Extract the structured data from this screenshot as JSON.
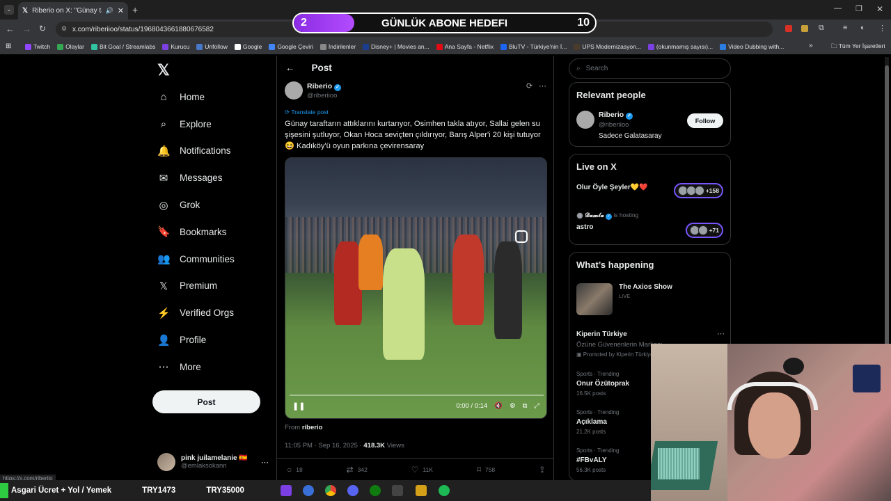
{
  "browser": {
    "tab_title": "Riberio on X: \"Günay taraftı",
    "url": "x.com/riberiioo/status/1968043661880676582",
    "status_url": "https://x.com/riberiio"
  },
  "bookmarks": [
    {
      "label": "Twitch",
      "color": "#9146ff"
    },
    {
      "label": "Olaylar",
      "color": "#34a853"
    },
    {
      "label": "Bit Goal / Streamlabs",
      "color": "#31c3a2"
    },
    {
      "label": "Kurucu",
      "color": "#7b3fe4"
    },
    {
      "label": "Unfollow",
      "color": "#4a78c9"
    },
    {
      "label": "Google",
      "color": "#ffffff"
    },
    {
      "label": "Google Çeviri",
      "color": "#4285f4"
    },
    {
      "label": "İndirilenler",
      "color": "#888888"
    },
    {
      "label": "Disney+ | Movies an...",
      "color": "#1a3d8f"
    },
    {
      "label": "Ana Sayfa - Netflix",
      "color": "#e50914"
    },
    {
      "label": "BluTV - Türkiye'nin İ...",
      "color": "#1c64f2"
    },
    {
      "label": "UPS Modernizasyon...",
      "color": "#4a3b2a"
    },
    {
      "label": "(okunmamış sayısı)...",
      "color": "#7b3fe4"
    },
    {
      "label": "Video Dubbing with...",
      "color": "#2a7de1"
    }
  ],
  "bookmarks_more": "»",
  "bookmarks_all": "Tüm Yer İşaretleri",
  "goal": {
    "current": "2",
    "label": "GÜNLÜK ABONE HEDEFI",
    "target": "10",
    "progress": 0.2
  },
  "nav": {
    "items": [
      "Home",
      "Explore",
      "Notifications",
      "Messages",
      "Grok",
      "Bookmarks",
      "Communities",
      "Premium",
      "Verified Orgs",
      "Profile",
      "More"
    ],
    "post_label": "Post",
    "account_name": "pink juilamelanie 🇪🇸",
    "account_handle": "@emlaksokann"
  },
  "post": {
    "header": "Post",
    "author_name": "Riberio",
    "author_handle": "@riberiioo",
    "translate": "Translate post",
    "text_line1": "Günay taraftarın attıklarını kurtarıyor, Osimhen takla atıyor, Sallai gelen su",
    "text_line2": "şişesini şutluyor, Okan Hoca seviçten çıldırıyor, Barış Alper'i 20 kişi tutuyor",
    "text_line3": "😆 Kadıköy'ü oyun parkına çevirensaray",
    "video_time": "0:00 / 0:14",
    "from_label": "From",
    "from_user": "riberio",
    "timestamp": "11:05 PM · Sep 16, 2025 · ",
    "views_count": "418.3K",
    "views_label": "Views",
    "replies": "18",
    "reposts": "342",
    "likes": "11K",
    "bookmarks": "758"
  },
  "search": {
    "placeholder": "Search"
  },
  "relevant": {
    "title": "Relevant people",
    "name": "Riberio",
    "handle": "@riberiioo",
    "bio": "Sadece Galatasaray",
    "follow": "Follow"
  },
  "live": {
    "title": "Live on X",
    "space1": "Olur Öyle Şeyler💛❤️",
    "space1_count": "+158",
    "host_name": "𝓓𝓪𝓶𝓵𝓪",
    "host_label": "is hosting",
    "space2": "astro",
    "space2_count": "+71"
  },
  "happening": {
    "title": "What’s happening",
    "show": "The Axios Show",
    "show_status": "LIVE",
    "promo_name": "Kiperin Türkiye",
    "promo_desc": "Özüne Güvenenlerin Markası",
    "promo_label": "Promoted by Kiperin Türkiye",
    "trends": [
      {
        "meta": "Sports · Trending",
        "name": "Onur Özütoprak",
        "posts": "16.5K posts"
      },
      {
        "meta": "Sports · Trending",
        "name": "Açıklama",
        "posts": "21.2K posts"
      },
      {
        "meta": "Sports · Trending",
        "name": "#FBvALY",
        "posts": "56.3K posts"
      }
    ]
  },
  "ticker": {
    "item1": "Asgari Ücret + Yol / Yemek",
    "item2": "TRY1473",
    "item3": "TRY35000"
  }
}
